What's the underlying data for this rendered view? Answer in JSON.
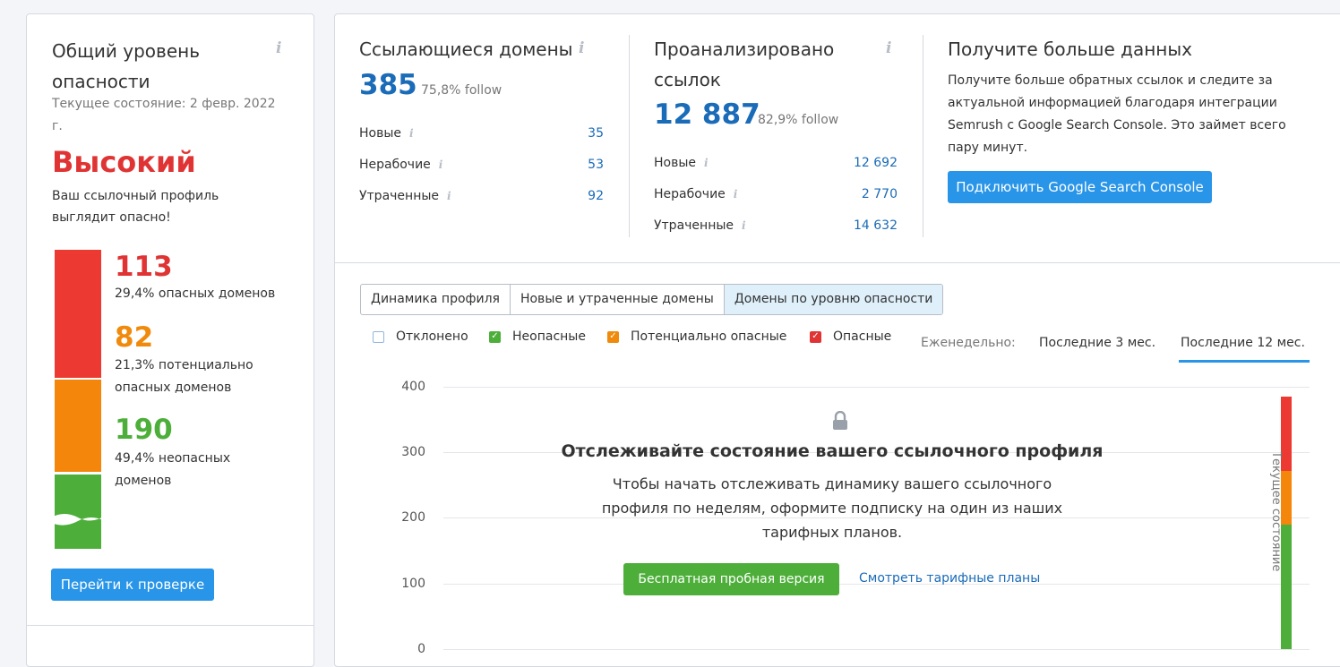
{
  "risk": {
    "title": "Общий уровень опасности",
    "updated": "Текущее состояние: 2 февр. 2022 г.",
    "level": "Высокий",
    "description": "Ваш ссылочный профиль выглядит опасно!",
    "stats": [
      {
        "value": "113",
        "label": "29,4% опасных доменов",
        "color": "#e03434"
      },
      {
        "value": "82",
        "label": "21,3% потенциально опасных доменов",
        "color": "#f08a0c"
      },
      {
        "value": "190",
        "label": "49,4% неопасных доменов",
        "color": "#4daf3a"
      }
    ],
    "button": "Перейти к проверке"
  },
  "referring": {
    "title": "Ссылающиеся домены",
    "total": "385",
    "follow": "75,8% follow",
    "rows": [
      {
        "label": "Новые",
        "value": "35"
      },
      {
        "label": "Нерабочие",
        "value": "53"
      },
      {
        "label": "Утраченные",
        "value": "92"
      }
    ]
  },
  "analyzed": {
    "title": "Проанализировано ссылок",
    "total": "12 887",
    "follow": "82,9% follow",
    "rows": [
      {
        "label": "Новые",
        "value": "12 692"
      },
      {
        "label": "Нерабочие",
        "value": "2 770"
      },
      {
        "label": "Утраченные",
        "value": "14 632"
      }
    ]
  },
  "promo": {
    "title": "Получите больше данных",
    "text": "Получите больше обратных ссылок и следите за актуальной информацией благодаря интеграции Semrush с Google Search Console. Это займет всего пару минут.",
    "button": "Подключить Google Search Console"
  },
  "tabs": [
    "Динамика профиля",
    "Новые и утраченные домены",
    "Домены по уровню опасности"
  ],
  "legend": [
    {
      "label": "Отклонено",
      "checked": false,
      "color": "#2995e8"
    },
    {
      "label": "Неопасные",
      "checked": true,
      "color": "#4daf3a"
    },
    {
      "label": "Потенциально опасные",
      "checked": true,
      "color": "#f08a0c"
    },
    {
      "label": "Опасные",
      "checked": true,
      "color": "#e03434"
    }
  ],
  "period": {
    "label": "Еженедельно:",
    "options": [
      "Последние 3 мес.",
      "Последние 12 мес."
    ]
  },
  "chart": {
    "y_ticks": [
      "400",
      "300",
      "200",
      "100",
      "0"
    ],
    "lock_title": "Отслеживайте состояние вашего ссылочного профиля",
    "lock_text": "Чтобы начать отслеживать динамику вашего ссылочного профиля по неделям, оформите подписку на один из наших тарифных планов.",
    "trial_button": "Бесплатная пробная версия",
    "plans_link": "Смотреть тарифные планы",
    "current_label": "Текущее состояние"
  },
  "chart_data": {
    "type": "bar",
    "categories": [
      "Текущее состояние"
    ],
    "series": [
      {
        "name": "Неопасные",
        "values": [
          190
        ]
      },
      {
        "name": "Потенциально опасные",
        "values": [
          82
        ]
      },
      {
        "name": "Опасные",
        "values": [
          113
        ]
      }
    ],
    "ylim": [
      0,
      400
    ],
    "y_ticks": [
      0,
      100,
      200,
      300,
      400
    ],
    "stacked": true,
    "grid": true
  }
}
